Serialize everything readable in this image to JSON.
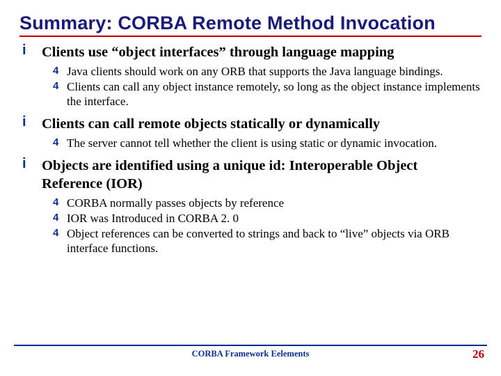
{
  "title": "Summary: CORBA Remote Method Invocation",
  "bullets": {
    "b0": {
      "head": "Clients use “object interfaces” through language mapping",
      "s0": "Java clients should work on any ORB that supports the Java language bindings.",
      "s1": "Clients can call any object instance remotely, so long as the object instance implements the interface."
    },
    "b1": {
      "head": "Clients can call remote objects statically or dynamically",
      "s0": "The server cannot tell whether the client is using static or dynamic invocation."
    },
    "b2": {
      "head": "Objects are identified using a unique id: Interoperable Object Reference (IOR)",
      "s0": "CORBA normally passes objects by reference",
      "s1": "IOR was Introduced in CORBA 2. 0",
      "s2": "Object references can be converted to strings and back to “live” objects via ORB interface functions."
    }
  },
  "footer": {
    "center": "CORBA Framework Eelements",
    "page": "26"
  },
  "markers": {
    "l1": "i",
    "l2": "4"
  }
}
